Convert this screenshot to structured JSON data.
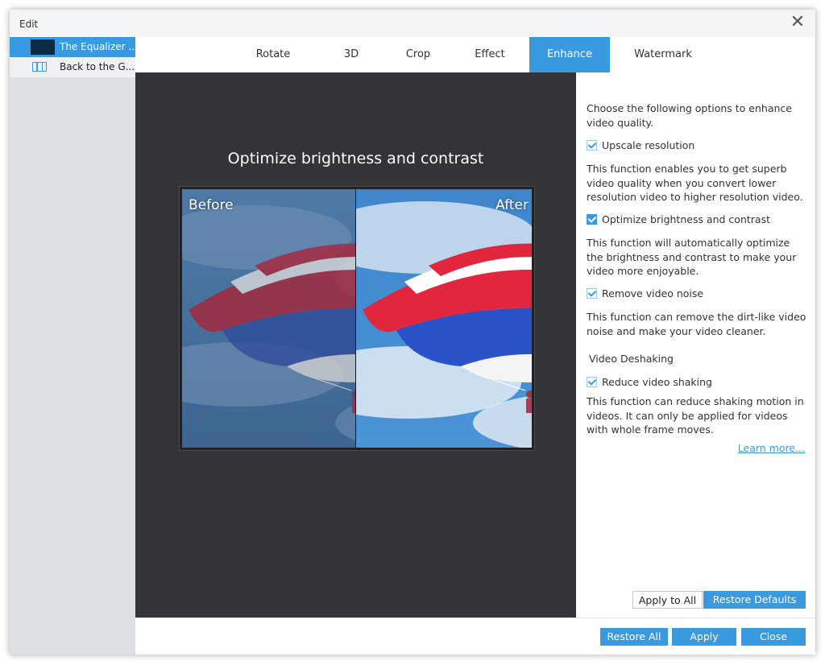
{
  "window": {
    "title": "Edit",
    "close_glyph": "✕"
  },
  "sidebar": {
    "items": [
      {
        "label": "The Equalizer ...",
        "icon": "video-thumbnail",
        "selected": true
      },
      {
        "label": "Back to the G...",
        "icon": "film-icon",
        "selected": false
      }
    ]
  },
  "tabs": [
    {
      "label": "Rotate"
    },
    {
      "label": "3D"
    },
    {
      "label": "Crop"
    },
    {
      "label": "Effect"
    },
    {
      "label": "Enhance",
      "active": true
    },
    {
      "label": "Watermark"
    }
  ],
  "preview": {
    "title": "Optimize brightness and contrast",
    "before_label": "Before",
    "after_label": "After"
  },
  "panel": {
    "intro": "Choose the following options to enhance video quality.",
    "options": [
      {
        "label": "Upscale resolution",
        "checked": false,
        "description": "This function enables you to get superb video quality when you convert lower resolution video to higher resolution video."
      },
      {
        "label": "Optimize brightness and contrast",
        "checked": true,
        "description": "This function will automatically optimize the brightness and contrast to make your video more enjoyable."
      },
      {
        "label": "Remove video noise",
        "checked": false,
        "description": "This function can remove the dirt-like video noise and make your video cleaner."
      }
    ],
    "deshake_heading": "Video Deshaking",
    "deshake_option": {
      "label": "Reduce video shaking",
      "checked": false,
      "description": "This function can reduce shaking motion in videos. It can only be applied for videos with whole frame moves."
    },
    "learn_more": "Learn more...",
    "apply_to_all": "Apply to All",
    "restore_defaults": "Restore Defaults"
  },
  "footer": {
    "restore_all": "Restore All",
    "apply": "Apply",
    "close": "Close"
  },
  "colors": {
    "accent": "#3a9ae0",
    "preview_bg": "#333437",
    "sidebar_bg": "#dde1e5"
  }
}
